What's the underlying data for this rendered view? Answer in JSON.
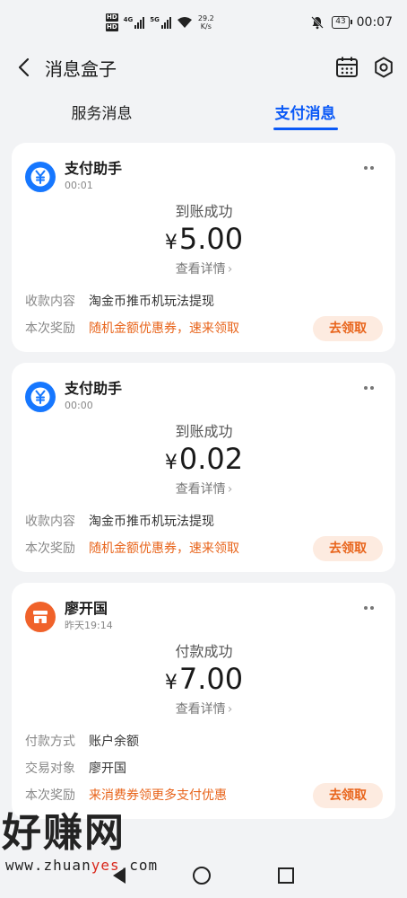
{
  "status_bar": {
    "hd_top": "HD",
    "hd_bottom": "HD",
    "sig1": "4G",
    "sig2": "5G",
    "speed_value": "29.2",
    "speed_unit": "K/s",
    "battery": "43",
    "time": "00:07"
  },
  "header": {
    "title": "消息盒子",
    "icons": [
      "back-arrow-icon",
      "calendar-icon",
      "settings-gear-icon"
    ]
  },
  "tabs": [
    {
      "label": "服务消息",
      "active": false
    },
    {
      "label": "支付消息",
      "active": true
    }
  ],
  "cards": [
    {
      "sender": "支付助手",
      "time": "00:01",
      "avatar_icon": "yuan-coin-icon",
      "status": "到账成功",
      "currency": "¥",
      "amount": "5.00",
      "detail": "查看详情",
      "rows": [
        {
          "label": "收款内容",
          "value": "淘金币推币机玩法提现"
        },
        {
          "label": "本次奖励",
          "value": "随机金额优惠券，速来领取"
        }
      ],
      "button": "去领取"
    },
    {
      "sender": "支付助手",
      "time": "00:00",
      "avatar_icon": "yuan-coin-icon",
      "status": "到账成功",
      "currency": "¥",
      "amount": "0.02",
      "detail": "查看详情",
      "rows": [
        {
          "label": "收款内容",
          "value": "淘金币推币机玩法提现"
        },
        {
          "label": "本次奖励",
          "value": "随机金额优惠券，速来领取"
        }
      ],
      "button": "去领取"
    },
    {
      "sender": "廖开国",
      "time": "昨天19:14",
      "avatar_icon": "store-icon",
      "status": "付款成功",
      "currency": "¥",
      "amount": "7.00",
      "detail": "查看详情",
      "rows": [
        {
          "label": "付款方式",
          "value": "账户余额"
        },
        {
          "label": "交易对象",
          "value": "廖开国"
        },
        {
          "label": "本次奖励",
          "value": "来消费券领更多支付优惠"
        }
      ],
      "button": "去领取"
    }
  ],
  "watermark": {
    "big": "好赚网",
    "small_a": "www.zhuan",
    "small_b": "yes",
    "small_c": ".com"
  },
  "colors": {
    "accent": "#0a59f7",
    "orange": "#e8641b",
    "avatar_blue": "#1677ff",
    "avatar_orange": "#f0622a"
  }
}
